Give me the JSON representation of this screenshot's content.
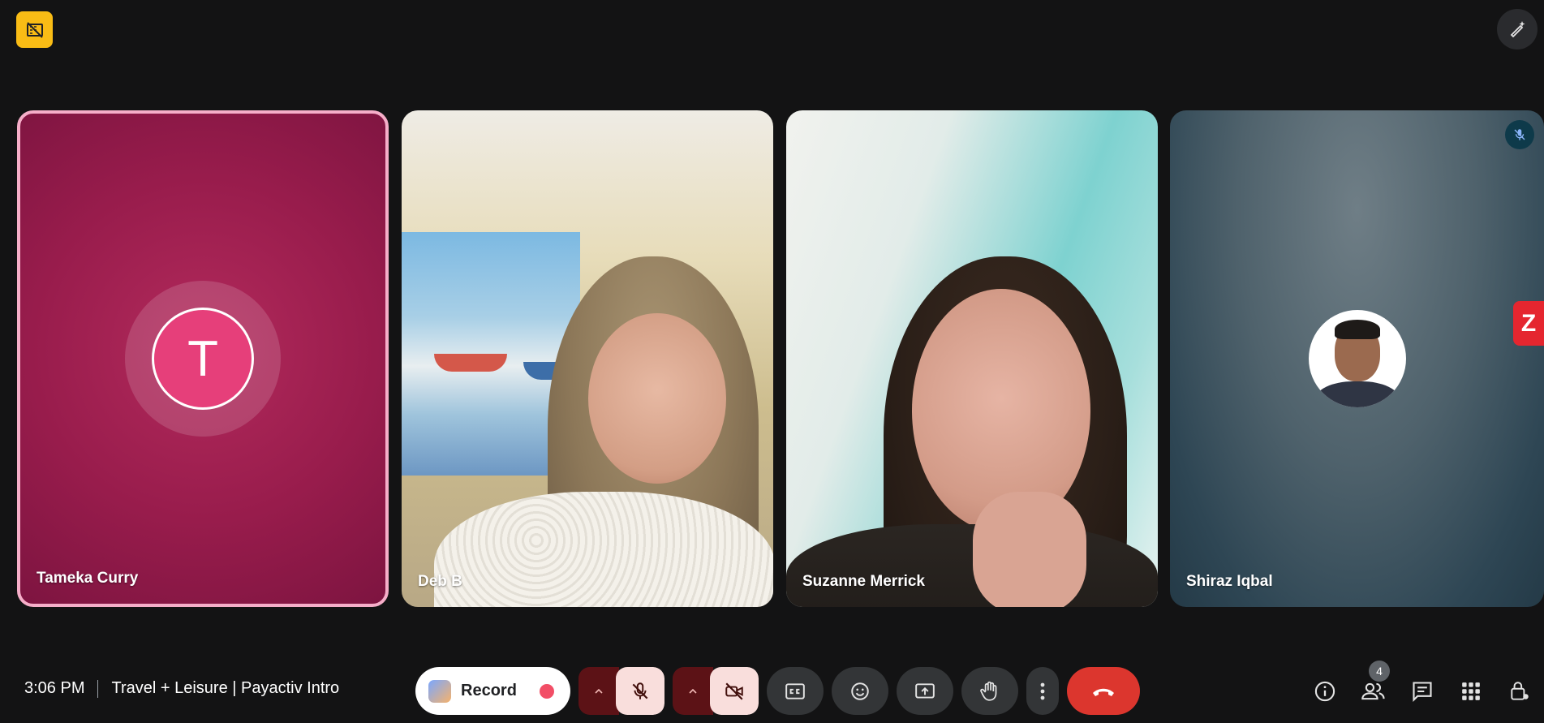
{
  "meeting": {
    "time": "3:06 PM",
    "title": "Travel + Leisure | Payactiv Intro"
  },
  "participants": [
    {
      "name": "Tameka Curry",
      "initial": "T",
      "avatar_color": "#e63f7a",
      "tile_color": "#9b1d4f",
      "speaking": true
    },
    {
      "name": "Deb B",
      "video": true
    },
    {
      "name": "Suzanne Merrick",
      "video": true
    },
    {
      "name": "Shiraz Iqbal",
      "muted": true,
      "photo_avatar": true
    }
  ],
  "controls": {
    "record_label": "Record",
    "participants_count": "4",
    "leave_color": "#dc362e",
    "muted_bg": "#f9dedc"
  },
  "icons": {
    "top_left": "recording-off-icon",
    "top_right": "pen-sparkle-icon",
    "side_tag": "zoom-icon",
    "side_tag_letter": "Z"
  }
}
